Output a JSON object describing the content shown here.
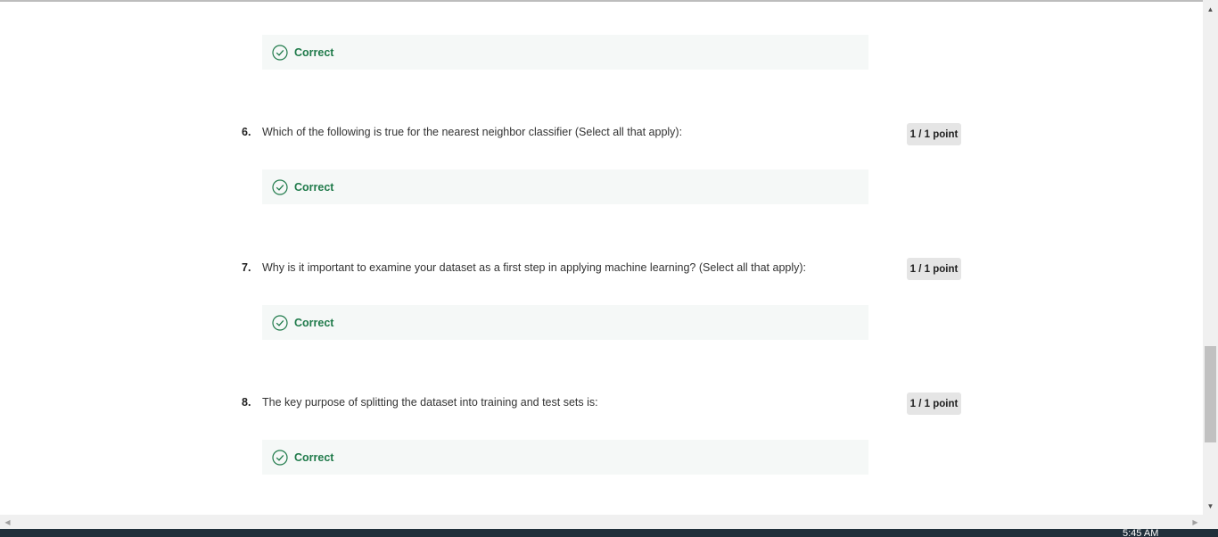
{
  "quiz": {
    "partial_top": {
      "feedback": "Correct"
    },
    "questions": [
      {
        "number": "6.",
        "text": "Which of the following is true for the nearest neighbor classifier (Select all that apply):",
        "points": "1 / 1 point",
        "feedback": "Correct"
      },
      {
        "number": "7.",
        "text": "Why is it important to examine your dataset as a first step in applying machine learning? (Select all that apply):",
        "points": "1 / 1 point",
        "feedback": "Correct"
      },
      {
        "number": "8.",
        "text": "The key purpose of splitting the dataset into training and test sets is:",
        "points": "1 / 1 point",
        "feedback": "Correct"
      }
    ]
  },
  "scrollbar": {
    "up_arrow": "▲",
    "down_arrow": "▼",
    "left_arrow": "◀",
    "right_arrow": "▶"
  },
  "taskbar": {
    "clock": "5:45 AM"
  },
  "colors": {
    "correct_green": "#1f7a4a",
    "feedback_bg": "#f5f8f7",
    "badge_bg": "#e5e5e5"
  },
  "icons": {
    "check": "check-circle-icon"
  }
}
